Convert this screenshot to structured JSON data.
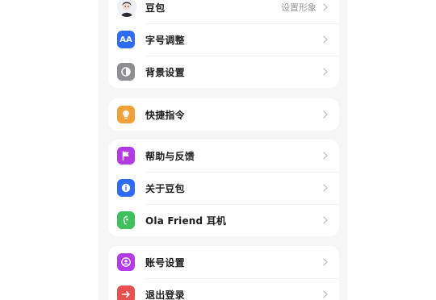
{
  "group1": {
    "doubao": {
      "label": "豆包",
      "value": "设置形象",
      "icon": "avatar-icon"
    },
    "font_size": {
      "label": "字号调整",
      "icon": "font-size-icon",
      "icon_text": "AA",
      "color": "#2f6cf6"
    },
    "background": {
      "label": "背景设置",
      "icon": "contrast-icon",
      "color": "#8e8e93"
    }
  },
  "group2": {
    "shortcut": {
      "label": "快捷指令",
      "icon": "lightbulb-icon",
      "color": "#f0a239"
    }
  },
  "group3": {
    "help": {
      "label": "帮助与反馈",
      "icon": "flag-icon",
      "color": "#b23be6"
    },
    "about": {
      "label": "关于豆包",
      "icon": "info-icon",
      "color": "#2f6cf6"
    },
    "ola": {
      "label": "Ola Friend 耳机",
      "icon": "earphone-icon",
      "color": "#3ec05e"
    }
  },
  "group4": {
    "account": {
      "label": "账号设置",
      "icon": "account-icon",
      "color": "#b23be6"
    },
    "logout": {
      "label": "退出登录",
      "icon": "logout-arrow-icon",
      "color": "#e8504f"
    }
  }
}
